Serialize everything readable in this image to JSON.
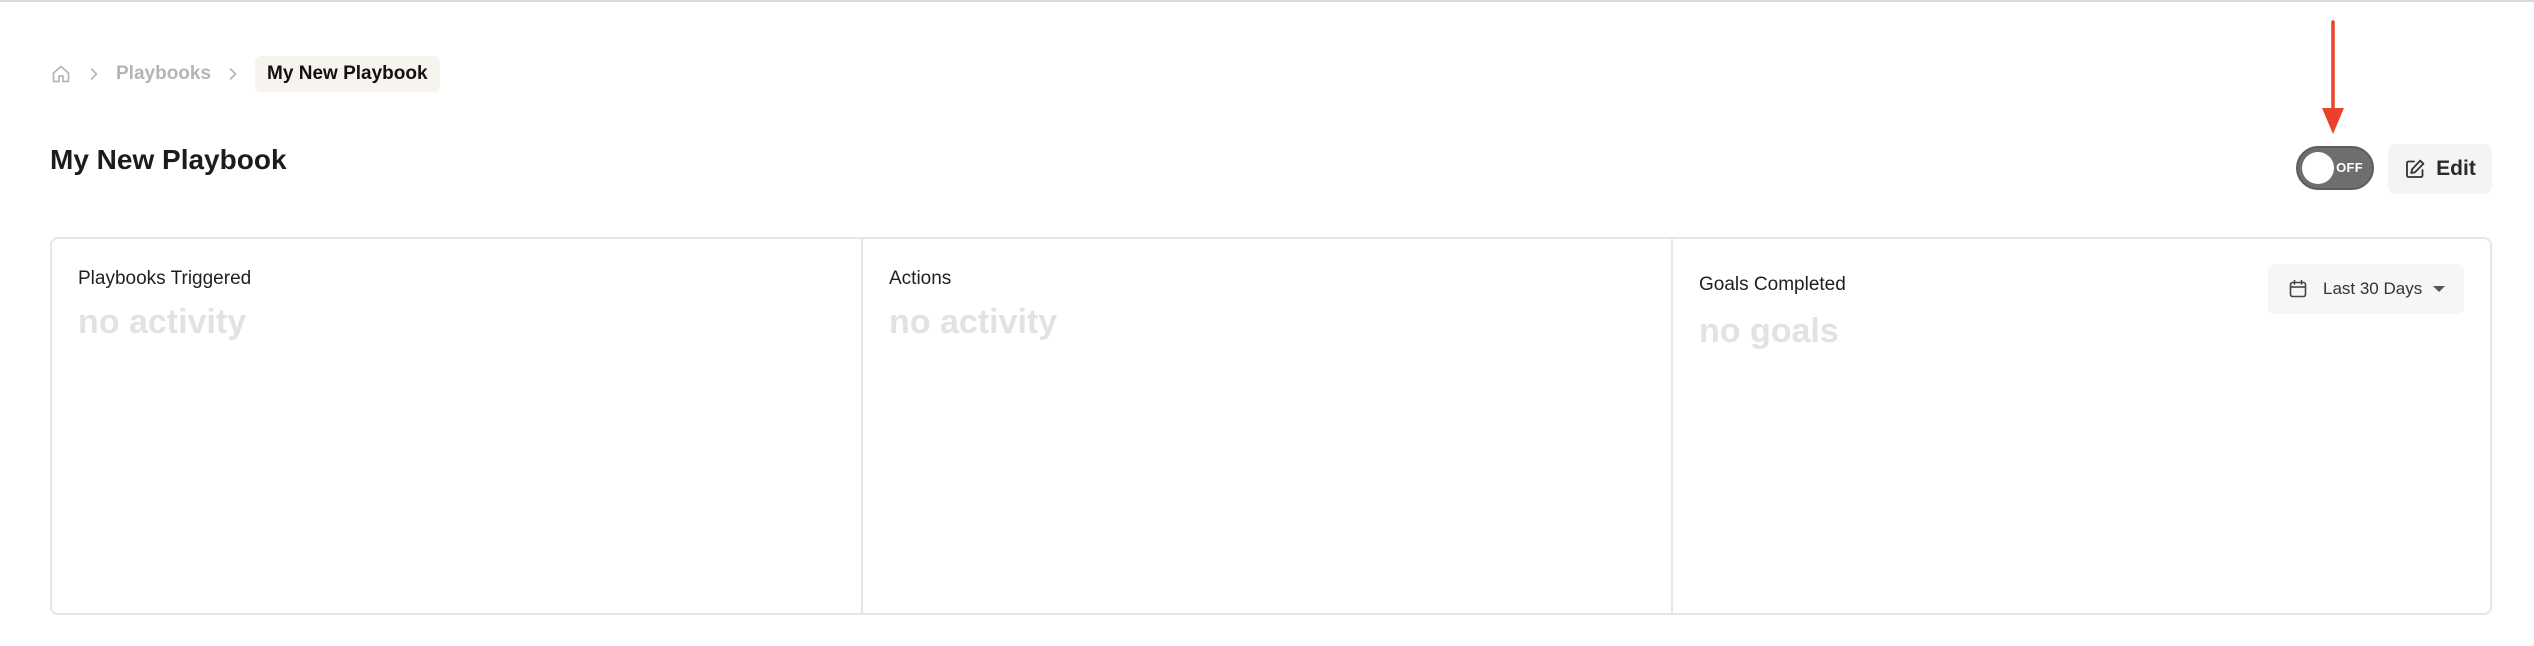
{
  "breadcrumb": {
    "home_icon": "home-icon",
    "items": [
      {
        "label": "Playbooks"
      },
      {
        "label": "My New Playbook"
      }
    ]
  },
  "page": {
    "title": "My New Playbook"
  },
  "toggle": {
    "state_label": "OFF",
    "enabled": false
  },
  "edit_button": {
    "label": "Edit",
    "icon": "edit-icon"
  },
  "stats": [
    {
      "label": "Playbooks Triggered",
      "value": "no activity"
    },
    {
      "label": "Actions",
      "value": "no activity"
    },
    {
      "label": "Goals Completed",
      "value": "no goals"
    }
  ],
  "date_range": {
    "selected": "Last 30 Days",
    "icon": "calendar-icon"
  },
  "colors": {
    "annotation_arrow": "#e8432a",
    "toggle_off": "#6e6e6e",
    "breadcrumb_current_bg": "#f7f4ef"
  }
}
